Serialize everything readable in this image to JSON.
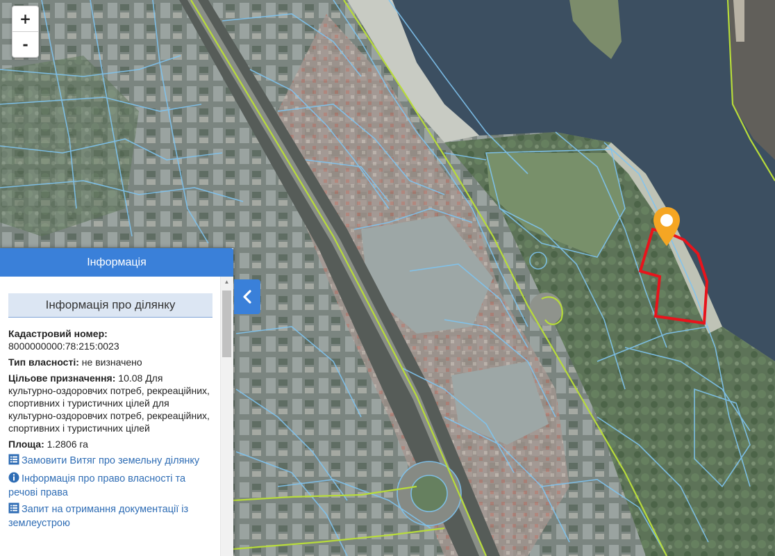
{
  "map": {
    "zoom_in_label": "+",
    "zoom_out_label": "-",
    "parcel_color": "#e8141c",
    "marker_color": "#f5a623",
    "boundary_color": "#7fc4f0"
  },
  "info_panel": {
    "header": "Інформація",
    "section_title": "Інформація про ділянку",
    "cadastral_label": "Кадастровий номер:",
    "cadastral_value": "8000000000:78:215:0023",
    "ownership_label": "Тип власності:",
    "ownership_value": " не визначено",
    "purpose_label": "Цільове призначення:",
    "purpose_value": " 10.08 Для культурно-оздоровчих потреб, рекреаційних, спортивних і туристичних цілей для культурно-оздоровчих потреб, рекреаційних, спортивних і туристичних цілей",
    "area_label": "Площа:",
    "area_value": " 1.2806 га",
    "links": [
      {
        "icon": "list-icon",
        "label": "Замовити Витяг про земельну ділянку"
      },
      {
        "icon": "info-icon",
        "label": "Інформація про право власності та речові права"
      },
      {
        "icon": "list-icon",
        "label": "Запит на отримання документації із землеустрою"
      }
    ],
    "accent_color": "#3a80d9"
  }
}
